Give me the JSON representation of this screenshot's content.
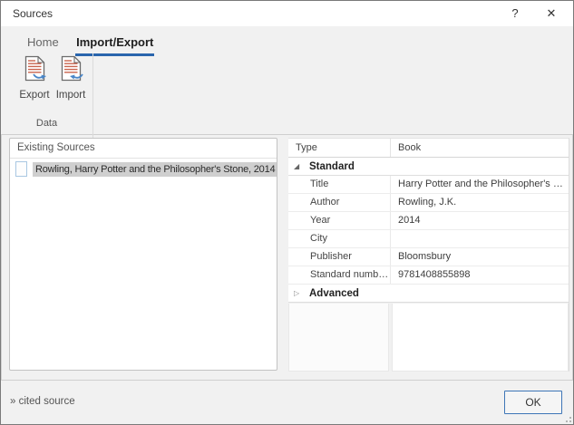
{
  "window": {
    "title": "Sources",
    "help_label": "?",
    "close_label": "✕"
  },
  "ribbon": {
    "tabs": [
      {
        "label": "Home",
        "active": false
      },
      {
        "label": "Import/Export",
        "active": true
      }
    ],
    "buttons": [
      {
        "label": "Export",
        "icon": "export-document-icon"
      },
      {
        "label": "Import",
        "icon": "import-document-icon"
      }
    ],
    "group_label": "Data"
  },
  "sources_list": {
    "header": "Existing Sources",
    "items": [
      {
        "label": "Rowling, Harry Potter and the Philosopher's Stone, 2014",
        "selected": true,
        "icon": "source-checkbox-icon"
      }
    ]
  },
  "properties": {
    "header": {
      "name": "Type",
      "value": "Book"
    },
    "sections": [
      {
        "label": "Standard",
        "expanded": true,
        "expand_icon": "◢",
        "rows": [
          {
            "name": "Title",
            "value": "Harry Potter and the Philosopher's …"
          },
          {
            "name": "Author",
            "value": "Rowling, J.K."
          },
          {
            "name": "Year",
            "value": "2014"
          },
          {
            "name": "City",
            "value": ""
          },
          {
            "name": "Publisher",
            "value": "Bloomsbury"
          },
          {
            "name": "Standard numb…",
            "value": "9781408855898"
          }
        ]
      },
      {
        "label": "Advanced",
        "expanded": false,
        "expand_icon": "▷",
        "rows": []
      }
    ]
  },
  "footer": {
    "status": "» cited source",
    "ok_label": "OK"
  },
  "colors": {
    "accent_blue": "#2a65ad",
    "selection_gray": "#cfcfcf",
    "icon_line_red": "#c9654f",
    "icon_arrow_blue": "#4a86c8"
  }
}
